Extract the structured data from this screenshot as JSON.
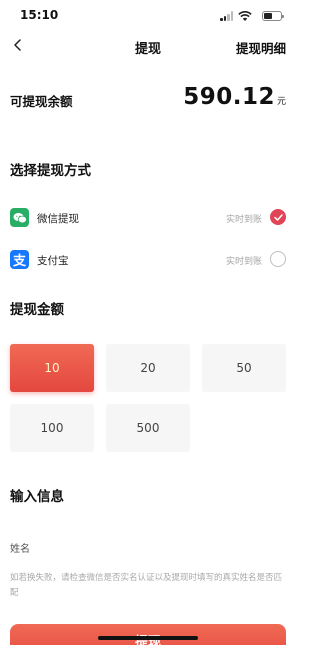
{
  "status_bar": {
    "time": "15:10"
  },
  "nav": {
    "title": "提现",
    "right_link": "提现明细"
  },
  "balance": {
    "label": "可提现余额",
    "amount": "590.12",
    "unit": "元"
  },
  "methods_section": {
    "title": "选择提现方式",
    "items": [
      {
        "name": "微信提现",
        "note": "实时到账",
        "icon": "wechat-icon",
        "selected": true
      },
      {
        "name": "支付宝",
        "note": "实时到账",
        "icon": "alipay-icon",
        "icon_glyph": "支",
        "selected": false
      }
    ]
  },
  "amount_section": {
    "title": "提现金额",
    "options": [
      "10",
      "20",
      "50",
      "100",
      "500"
    ],
    "selected": "10"
  },
  "info_section": {
    "title": "输入信息",
    "name_label": "姓名",
    "hint": "如若换失败，请检查微信是否实名认证以及提现时填写的真实姓名是否匹配"
  },
  "submit": {
    "label": "提现"
  },
  "colors": {
    "accent": "#e4473f",
    "wechat": "#2aae67",
    "alipay": "#1677ff"
  }
}
